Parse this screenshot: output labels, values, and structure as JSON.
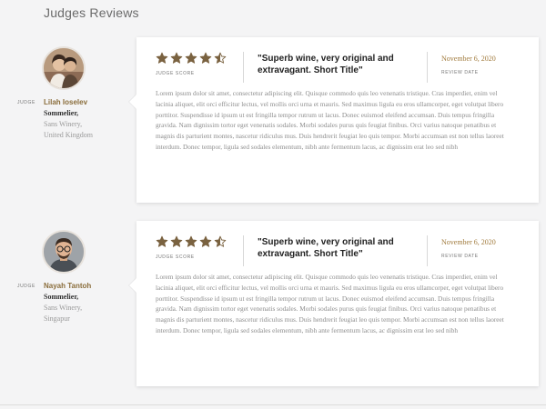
{
  "section": {
    "title": "Judges Reviews"
  },
  "colors": {
    "accent": "#8a6d3b",
    "star": "#7a6240",
    "date": "#a07a3c"
  },
  "reviews": [
    {
      "judge": {
        "tag": "JUDGE",
        "name": "Lilah Ioselev",
        "role": "Sommelier,",
        "company": "Sans Winery,",
        "location": "United Kingdom",
        "avatar_icon": "avatar-couple"
      },
      "rating": 4.5,
      "score_label": "JUDGE SCORE",
      "title": "\"Superb wine, very original and extravagant. Short Title\"",
      "date": "November 6, 2020",
      "date_label": "REVIEW DATE",
      "body": "Lorem ipsum dolor sit amet, consectetur adipiscing elit. Quisque commodo quis leo venenatis tristique. Cras imperdiet, enim vel lacinia aliquet, elit orci efficitur lectus, vel mollis orci urna et mauris. Sed maximus ligula eu eros ullamcorper, eget volutpat libero porttitor. Suspendisse id ipsum ut est fringilla tempor rutrum ut lacus. Donec euismod eleifend accumsan. Duis tempus fringilla gravida. Nam dignissim tortor eget venenatis sodales. Morbi sodales purus quis feugiat finibus. Orci varius natoque penatibus et magnis dis parturient montes, nascetur ridiculus mus. Duis hendrerit feugiat leo quis tempor. Morbi accumsan est non tellus laoreet interdum. Donec tempor, ligula sed sodales elementum, nibh ante fermentum lacus, ac dignissim erat leo sed nibh"
    },
    {
      "judge": {
        "tag": "JUDGE",
        "name": "Nayah Tantoh",
        "role": "Sommelier,",
        "company": "Sans Winery,",
        "location": "Singapur",
        "avatar_icon": "avatar-man-glasses"
      },
      "rating": 4.5,
      "score_label": "JUDGE SCORE",
      "title": "\"Superb wine, very original and extravagant. Short Title\"",
      "date": "November 6, 2020",
      "date_label": "REVIEW DATE",
      "body": "Lorem ipsum dolor sit amet, consectetur adipiscing elit. Quisque commodo quis leo venenatis tristique. Cras imperdiet, enim vel lacinia aliquet, elit orci efficitur lectus, vel mollis orci urna et mauris. Sed maximus ligula eu eros ullamcorper, eget volutpat libero porttitor. Suspendisse id ipsum ut est fringilla tempor rutrum ut lacus. Donec euismod eleifend accumsan. Duis tempus fringilla gravida. Nam dignissim tortor eget venenatis sodales. Morbi sodales purus quis feugiat finibus. Orci varius natoque penatibus et magnis dis parturient montes, nascetur ridiculus mus. Duis hendrerit feugiat leo quis tempor. Morbi accumsan est non tellus laoreet interdum. Donec tempor, ligula sed sodales elementum, nibh ante fermentum lacus, ac dignissim erat leo sed nibh"
    }
  ]
}
